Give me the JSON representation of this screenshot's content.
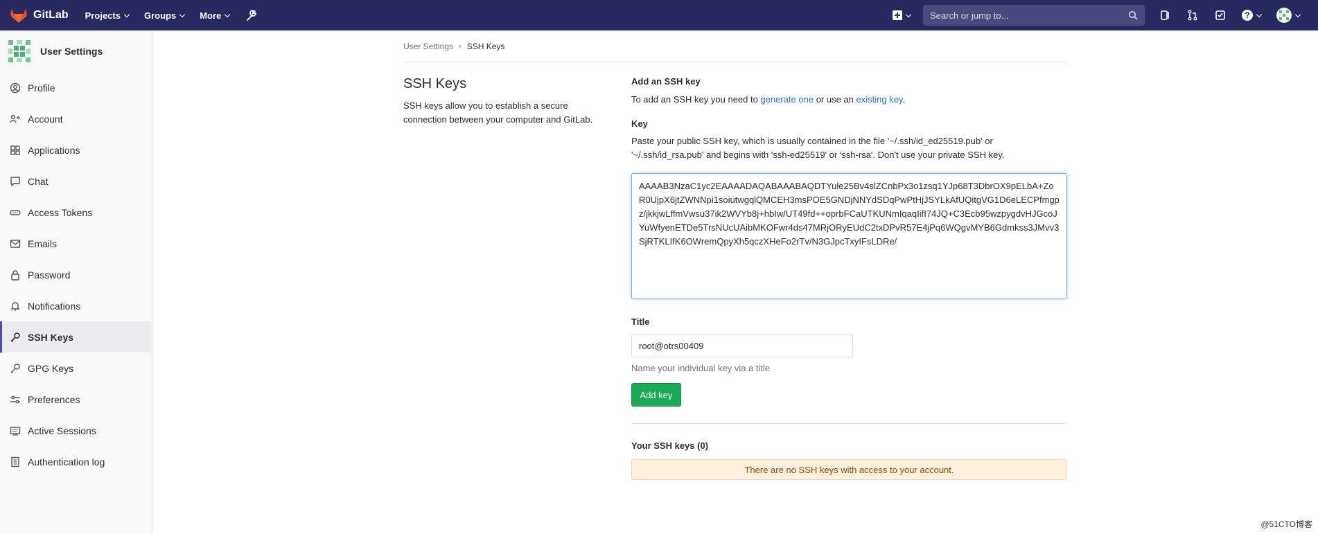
{
  "topbar": {
    "brand": "GitLab",
    "menu": [
      {
        "label": "Projects"
      },
      {
        "label": "Groups"
      },
      {
        "label": "More"
      }
    ],
    "search_placeholder": "Search or jump to..."
  },
  "sidebar": {
    "title": "User Settings",
    "items": [
      {
        "label": "Profile",
        "icon": "profile-icon"
      },
      {
        "label": "Account",
        "icon": "account-icon"
      },
      {
        "label": "Applications",
        "icon": "applications-icon"
      },
      {
        "label": "Chat",
        "icon": "chat-icon"
      },
      {
        "label": "Access Tokens",
        "icon": "token-icon"
      },
      {
        "label": "Emails",
        "icon": "email-icon"
      },
      {
        "label": "Password",
        "icon": "lock-icon"
      },
      {
        "label": "Notifications",
        "icon": "bell-icon"
      },
      {
        "label": "SSH Keys",
        "icon": "key-icon",
        "active": true
      },
      {
        "label": "GPG Keys",
        "icon": "key-icon"
      },
      {
        "label": "Preferences",
        "icon": "preferences-icon"
      },
      {
        "label": "Active Sessions",
        "icon": "sessions-icon"
      },
      {
        "label": "Authentication log",
        "icon": "log-icon"
      }
    ]
  },
  "breadcrumb": {
    "parent": "User Settings",
    "current": "SSH Keys"
  },
  "section": {
    "title": "SSH Keys",
    "description": "SSH keys allow you to establish a secure connection between your computer and GitLab."
  },
  "form": {
    "add_heading": "Add an SSH key",
    "add_prefix": "To add an SSH key you need to ",
    "generate_link": "generate one",
    "add_middle": " or use an ",
    "existing_link": "existing key",
    "add_suffix": ".",
    "key_label": "Key",
    "key_help": "Paste your public SSH key, which is usually contained in the file '~/.ssh/id_ed25519.pub' or '~/.ssh/id_rsa.pub' and begins with 'ssh-ed25519' or 'ssh-rsa'. Don't use your private SSH key.",
    "key_value": "AAAAB3NzaC1yc2EAAAADAQABAAABAQDTYule25Bv4slZCnbPx3o1zsq1YJp68T3DbrOX9pELbA+ZoR0UjpX6jtZWNNpi1soiutwgqlQMCEH3msPOE5GNDjNNYdSDqPwPtHjJSYLkAfUQitgVG1D6eLECPfmgpz/jkkjwLffmVwsu37ik2WVYb8j+hbIw/UT49fd++oprbFCaUTKUNmIqaqIifI74JQ+C3Ecb95wzpygdvHJGcoJYuWfyenETDe5TrsNUcUAibMKOFwr4ds47MRjORyEUdC2txDPvR57E4jPq6WQgvMYB6Gdmkss3JMvv3SjRTKLIfK6OWremQpyXh5qczXHeFo2rTv/N3GJpcTxyIFsLDRe/",
    "title_label": "Title",
    "title_value": "root@otrs00409",
    "title_help": "Name your individual key via a title",
    "submit_label": "Add key"
  },
  "keys_list": {
    "heading": "Your SSH keys (0)",
    "empty_message": "There are no SSH keys with access to your account."
  },
  "watermark": "@51CTO博客"
}
